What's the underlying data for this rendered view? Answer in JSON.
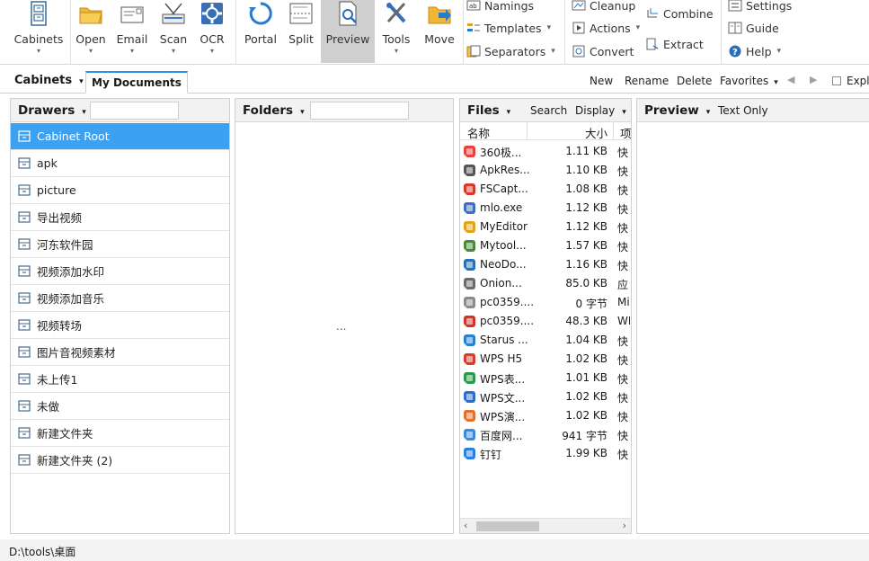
{
  "ribbon": {
    "buttons": [
      {
        "label": "Cabinets",
        "icon": "cabinet-icon",
        "dropdown": true
      },
      {
        "label": "Open",
        "icon": "folder-open-icon",
        "dropdown": true
      },
      {
        "label": "Email",
        "icon": "email-icon",
        "dropdown": true
      },
      {
        "label": "Scan",
        "icon": "scanner-icon",
        "dropdown": true
      },
      {
        "label": "OCR",
        "icon": "ocr-icon",
        "dropdown": true
      },
      {
        "label": "Portal",
        "icon": "portal-icon"
      },
      {
        "label": "Split",
        "icon": "split-icon"
      },
      {
        "label": "Preview",
        "icon": "preview-icon",
        "active": true
      },
      {
        "label": "Tools",
        "icon": "tools-icon",
        "dropdown": true
      },
      {
        "label": "Move",
        "icon": "move-icon"
      }
    ],
    "group1": [
      "Namings",
      "Templates",
      "Separators"
    ],
    "group2": [
      "Cleanup",
      "Actions",
      "Convert"
    ],
    "group3": [
      "Combine",
      "Extract"
    ],
    "group4": [
      "Settings",
      "Guide",
      "Help"
    ]
  },
  "tabbar": {
    "cabinets_label": "Cabinets",
    "active_tab": "My Documents",
    "actions": [
      "New",
      "Rename",
      "Delete",
      "Favorites"
    ],
    "explore_label": "Explo"
  },
  "drawers": {
    "title": "Drawers",
    "items": [
      {
        "label": "Cabinet Root",
        "selected": true
      },
      {
        "label": "apk"
      },
      {
        "label": "picture"
      },
      {
        "label": "导出视频"
      },
      {
        "label": "河东软件园"
      },
      {
        "label": "视频添加水印"
      },
      {
        "label": "视频添加音乐"
      },
      {
        "label": "视频转场"
      },
      {
        "label": "图片音视频素材"
      },
      {
        "label": "未上传1"
      },
      {
        "label": "未做"
      },
      {
        "label": "新建文件夹"
      },
      {
        "label": "新建文件夹 (2)"
      }
    ]
  },
  "folders": {
    "title": "Folders",
    "placeholder_text": "..."
  },
  "files": {
    "title": "Files",
    "search_label": "Search",
    "display_label": "Display",
    "columns": {
      "name": "名称",
      "size": "大小",
      "type": "项"
    },
    "rows": [
      {
        "name": "360极...",
        "size": "1.11 KB",
        "type": "快",
        "color": "#e8413c"
      },
      {
        "name": "ApkRes...",
        "size": "1.10 KB",
        "type": "快",
        "color": "#555555"
      },
      {
        "name": "FSCapt...",
        "size": "1.08 KB",
        "type": "快",
        "color": "#d33a2c"
      },
      {
        "name": "mlo.exe",
        "size": "1.12 KB",
        "type": "快",
        "color": "#3a6fc4"
      },
      {
        "name": "MyEditor",
        "size": "1.12 KB",
        "type": "快",
        "color": "#e2a21b"
      },
      {
        "name": "Mytool...",
        "size": "1.57 KB",
        "type": "快",
        "color": "#4a8a3a"
      },
      {
        "name": "NeoDo...",
        "size": "1.16 KB",
        "type": "快",
        "color": "#2c6fb3"
      },
      {
        "name": "Onion...",
        "size": "85.0 KB",
        "type": "应",
        "color": "#6a6a6a"
      },
      {
        "name": "pc0359....",
        "size": "0 字节",
        "type": "Mi",
        "color": "#8a8a8a"
      },
      {
        "name": "pc0359....",
        "size": "48.3 KB",
        "type": "WF",
        "color": "#d2332a"
      },
      {
        "name": "Starus ...",
        "size": "1.04 KB",
        "type": "快",
        "color": "#2a7fd0"
      },
      {
        "name": "WPS H5",
        "size": "1.02 KB",
        "type": "快",
        "color": "#d83a2e"
      },
      {
        "name": "WPS表...",
        "size": "1.01 KB",
        "type": "快",
        "color": "#2a9a4a"
      },
      {
        "name": "WPS文...",
        "size": "1.02 KB",
        "type": "快",
        "color": "#2a6fd0"
      },
      {
        "name": "WPS演...",
        "size": "1.02 KB",
        "type": "快",
        "color": "#e0702a"
      },
      {
        "name": "百度网...",
        "size": "941 字节",
        "type": "快",
        "color": "#3a8ae0"
      },
      {
        "name": "钉钉",
        "size": "1.99 KB",
        "type": "快",
        "color": "#2a7fe0"
      }
    ]
  },
  "preview": {
    "title": "Preview",
    "mode": "Text Only"
  },
  "status": {
    "path": "D:\\tools\\桌面"
  },
  "colors": {
    "selection": "#3ba1f0",
    "tab_accent": "#2b8ee8"
  }
}
